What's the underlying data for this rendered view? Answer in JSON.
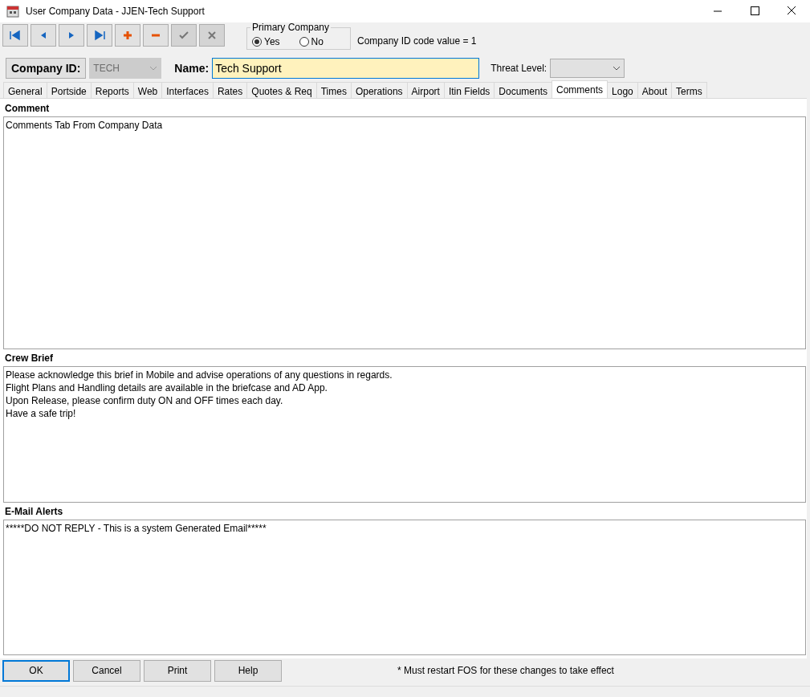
{
  "window": {
    "title": "User Company Data - JJEN-Tech Support"
  },
  "toolbar": [
    {
      "kind": "first",
      "disabled": false
    },
    {
      "kind": "prev",
      "disabled": false
    },
    {
      "kind": "next",
      "disabled": false
    },
    {
      "kind": "last",
      "disabled": false
    },
    {
      "kind": "add",
      "disabled": false
    },
    {
      "kind": "delete",
      "disabled": false
    },
    {
      "kind": "save",
      "disabled": true
    },
    {
      "kind": "cancel",
      "disabled": true
    }
  ],
  "primary_company": {
    "legend": "Primary Company",
    "options": [
      {
        "label": "Yes",
        "selected": true
      },
      {
        "label": "No",
        "selected": false
      }
    ]
  },
  "company_id_code": "Company ID code value = 1",
  "company_id": {
    "label": "Company ID:",
    "value": "TECH"
  },
  "name": {
    "label": "Name:",
    "value": "Tech Support"
  },
  "threat_level": {
    "label": "Threat Level:"
  },
  "tabs": [
    {
      "label": "General",
      "selected": false
    },
    {
      "label": "Portside",
      "selected": false
    },
    {
      "label": "Reports",
      "selected": false
    },
    {
      "label": "Web",
      "selected": false
    },
    {
      "label": "Interfaces",
      "selected": false
    },
    {
      "label": "Rates",
      "selected": false
    },
    {
      "label": "Quotes & Req",
      "selected": false
    },
    {
      "label": "Times",
      "selected": false
    },
    {
      "label": "Operations",
      "selected": false
    },
    {
      "label": "Airport",
      "selected": false
    },
    {
      "label": "Itin Fields",
      "selected": false
    },
    {
      "label": "Documents",
      "selected": false
    },
    {
      "label": "Comments",
      "selected": true
    },
    {
      "label": "Logo",
      "selected": false
    },
    {
      "label": "About",
      "selected": false
    },
    {
      "label": "Terms",
      "selected": false
    }
  ],
  "sections": [
    {
      "label": "Comment",
      "value": "Comments Tab From Company Data"
    },
    {
      "label": "Crew Brief",
      "value": "Please acknowledge this brief in Mobile and advise operations of any questions in regards.\nFlight Plans and Handling details are available in the briefcase and AD App.\nUpon Release, please confirm duty ON and OFF times each day.\nHave a safe trip!"
    },
    {
      "label": "E-Mail Alerts",
      "value": "*****DO NOT REPLY - This is a system Generated Email*****"
    }
  ],
  "buttons": [
    {
      "label": "OK",
      "selected": true
    },
    {
      "label": "Cancel",
      "selected": false
    },
    {
      "label": "Print",
      "selected": false
    },
    {
      "label": "Help",
      "selected": false
    }
  ],
  "footer_note": "* Must restart FOS for these changes to take effect"
}
